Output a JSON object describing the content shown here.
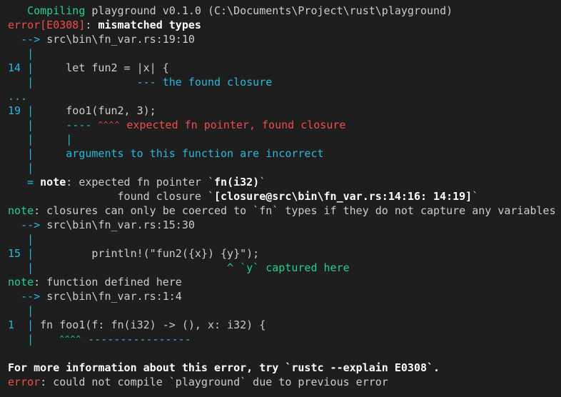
{
  "colors": {
    "background": "#1e1e1e",
    "text": "#cccccc",
    "green": "#23d18b",
    "red": "#f14c4c",
    "blue": "#29b8db",
    "bold": "#ffffff"
  },
  "lines": [
    [
      [
        "   Compiling",
        "g"
      ],
      [
        " playground v0.1.0 (C:\\Documents\\Project\\rust\\playground)",
        ""
      ]
    ],
    [
      [
        "error[E0308]",
        "r"
      ],
      [
        ": ",
        ""
      ],
      [
        "mismatched types",
        "w"
      ]
    ],
    [
      [
        "  --> ",
        "b"
      ],
      [
        "src\\bin\\fn_var.rs:19:10",
        ""
      ]
    ],
    [
      [
        "   |",
        "b"
      ]
    ],
    [
      [
        "14 |",
        "b"
      ],
      [
        "     let fun2 = |x| {",
        ""
      ]
    ],
    [
      [
        "   |",
        "b"
      ],
      [
        "                --- the found closure",
        "b"
      ]
    ],
    [
      [
        "...",
        "b"
      ]
    ],
    [
      [
        "19 |",
        "b"
      ],
      [
        "     foo1(fun2, 3);",
        ""
      ]
    ],
    [
      [
        "   |",
        "b"
      ],
      [
        "     ----",
        "b"
      ],
      [
        " ",
        ""
      ],
      [
        "^^^^",
        "sq-r"
      ],
      [
        " expected fn pointer, found closure",
        "r"
      ]
    ],
    [
      [
        "   |     |",
        "b"
      ]
    ],
    [
      [
        "   |",
        "b"
      ],
      [
        "     arguments to this function are incorrect",
        "b"
      ]
    ],
    [
      [
        "   |",
        "b"
      ]
    ],
    [
      [
        "   = ",
        "b"
      ],
      [
        "note",
        "w"
      ],
      [
        ": expected fn pointer `",
        ""
      ],
      [
        "fn(i32)",
        "w"
      ],
      [
        "`",
        ""
      ]
    ],
    [
      [
        "                 found closure `",
        ""
      ],
      [
        "[closure@src\\bin\\fn_var.rs:14:16: 14:19]",
        "w"
      ],
      [
        "`",
        ""
      ]
    ],
    [
      [
        "note",
        "g"
      ],
      [
        ": closures can only be coerced to `fn` types if they do not capture any variables",
        ""
      ]
    ],
    [
      [
        "  --> ",
        "b"
      ],
      [
        "src\\bin\\fn_var.rs:15:30",
        ""
      ]
    ],
    [
      [
        "   |",
        "b"
      ]
    ],
    [
      [
        "15 |",
        "b"
      ],
      [
        "         println!(\"fun2({x}) {y}\");",
        ""
      ]
    ],
    [
      [
        "   |",
        "b"
      ],
      [
        "                              ^ `y` captured here",
        "g"
      ]
    ],
    [
      [
        "note",
        "g"
      ],
      [
        ": function defined here",
        ""
      ]
    ],
    [
      [
        "  --> ",
        "b"
      ],
      [
        "src\\bin\\fn_var.rs:1:4",
        ""
      ]
    ],
    [
      [
        "   |",
        "b"
      ]
    ],
    [
      [
        "1  |",
        "b"
      ],
      [
        " fn foo1(f: fn(i32) -> (), x: i32) {",
        ""
      ]
    ],
    [
      [
        "   |",
        "b"
      ],
      [
        "    ",
        ""
      ],
      [
        "^^^^",
        "sq-g"
      ],
      [
        " ",
        ""
      ],
      [
        "----------------",
        "b"
      ]
    ],
    [
      [
        "",
        ""
      ]
    ],
    [
      [
        "For more information about this error, try `rustc --explain E0308`.",
        "w"
      ]
    ],
    [
      [
        "error",
        "r"
      ],
      [
        ": could not compile `playground` due to previous error",
        ""
      ]
    ]
  ]
}
